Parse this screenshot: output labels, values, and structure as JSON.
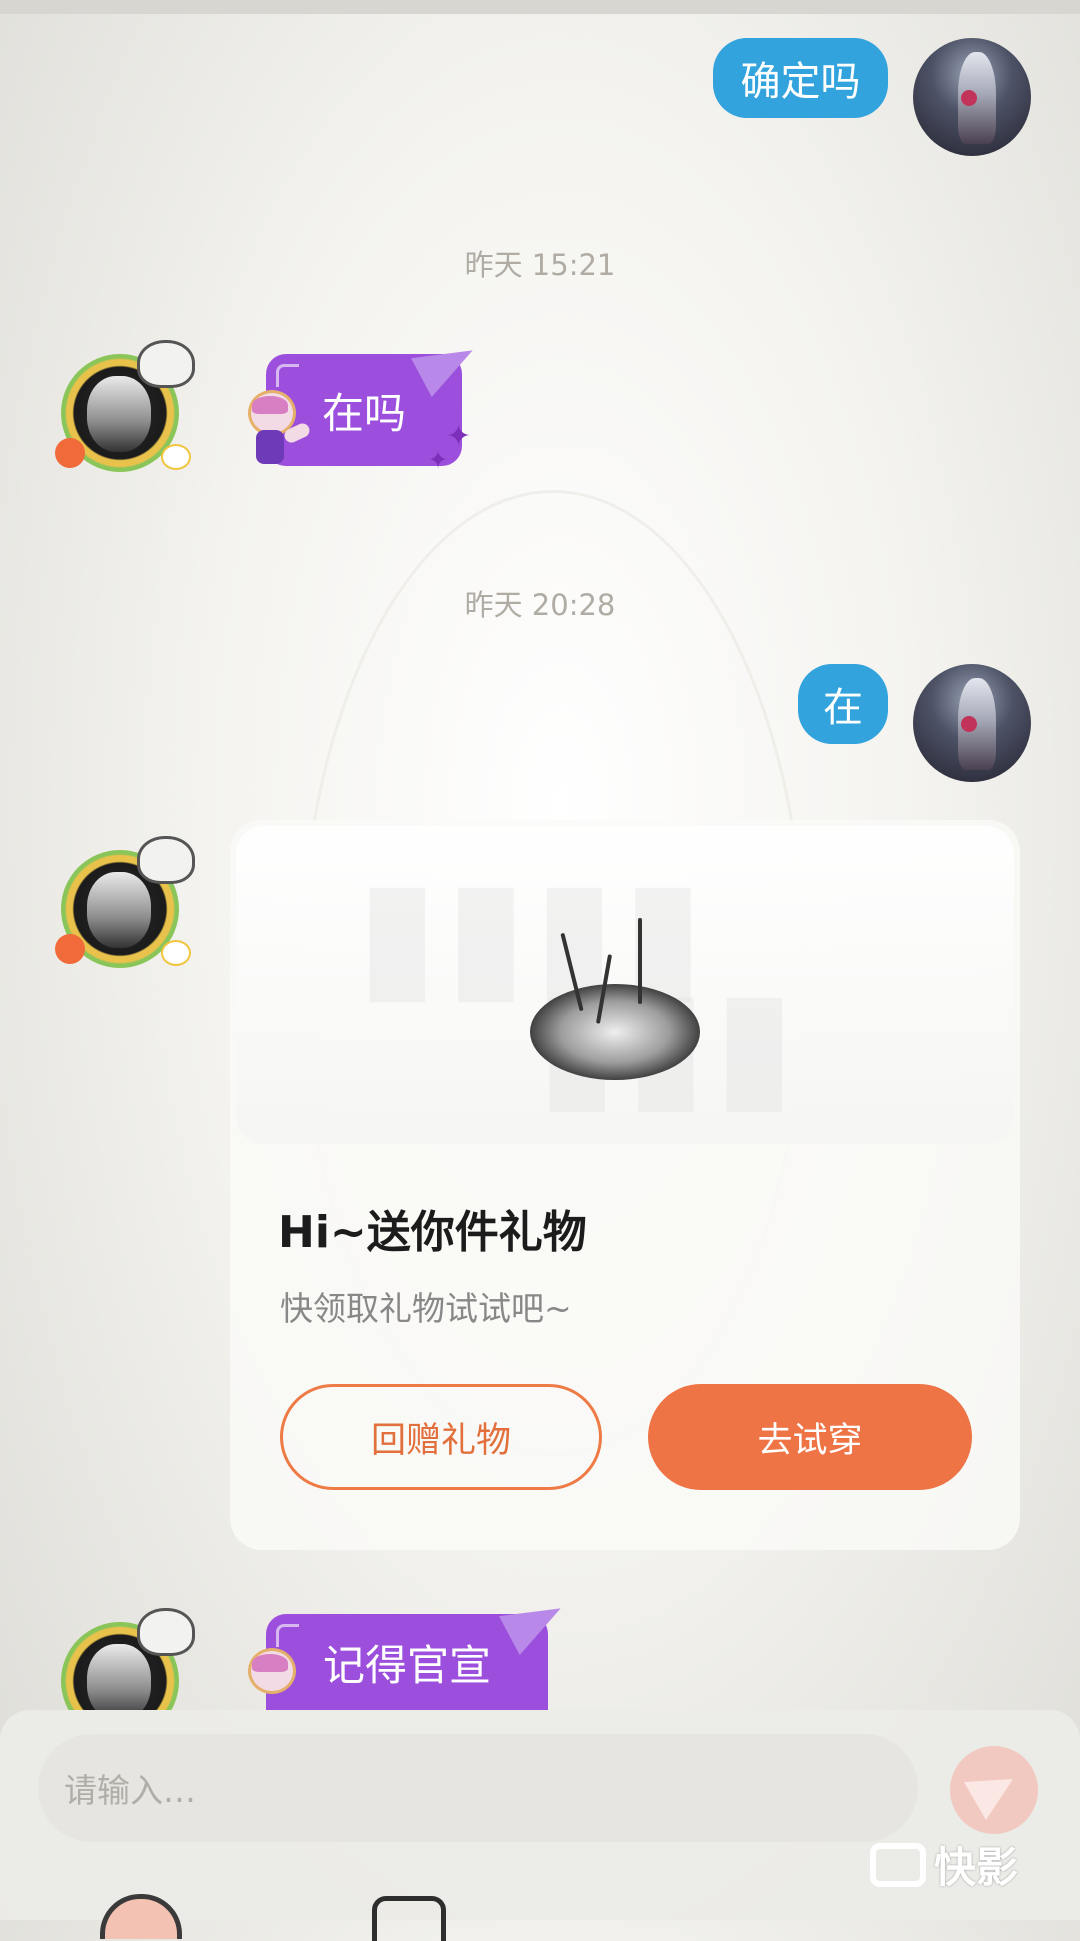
{
  "messages": {
    "m1": {
      "text": "确定吗"
    },
    "time1": "昨天 15:21",
    "m2": {
      "text": "在吗"
    },
    "time2": "昨天 20:28",
    "m3": {
      "text": "在"
    },
    "m5": {
      "text": "记得官宣"
    }
  },
  "gift_card": {
    "title": "Hi~送你件礼物",
    "subtitle": "快领取礼物试试吧~",
    "return_gift_label": "回赠礼物",
    "try_on_label": "去试穿"
  },
  "input": {
    "placeholder": "请输入…"
  },
  "watermark": {
    "text": "快影"
  },
  "colors": {
    "self_bubble": "#32a3dc",
    "other_bubble": "#9b4fdc",
    "accent_orange": "#ee7446"
  },
  "icons": [
    "send-icon",
    "paper-plane-icon",
    "sparkle-icon",
    "camera-icon"
  ]
}
